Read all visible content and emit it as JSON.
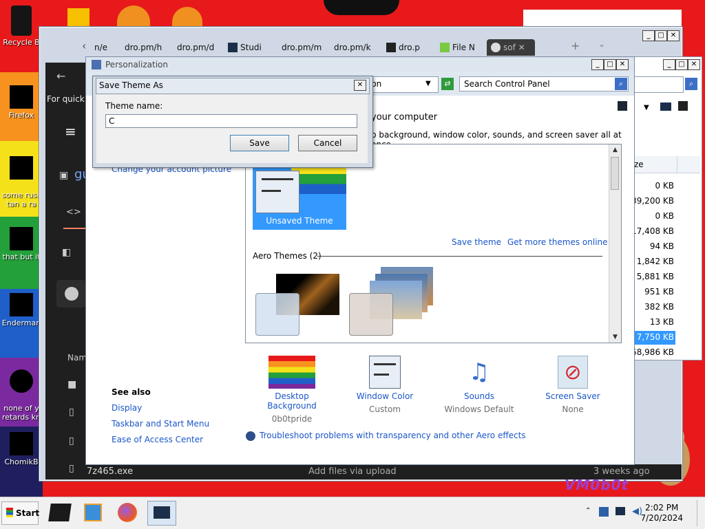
{
  "desktop": {
    "icons": [
      {
        "label": "Recycle B"
      },
      {
        "label": "Firefox"
      },
      {
        "label": "some russ\ntan a ra"
      },
      {
        "label": "that but it"
      },
      {
        "label": "Enderman"
      },
      {
        "label": "none of y\nretards kn"
      },
      {
        "label": "ChomikB"
      }
    ],
    "stripe_colors": [
      "#e8191b",
      "#f7921e",
      "#f5e11a",
      "#23a03a",
      "#1f5fc9",
      "#7a2a9e"
    ]
  },
  "browser": {
    "tabs": [
      {
        "label": "n/e"
      },
      {
        "label": "dro.pm/h"
      },
      {
        "label": "dro.pm/d"
      },
      {
        "label": "Studi"
      },
      {
        "label": "dro.pm/m"
      },
      {
        "label": "dro.pm/k"
      },
      {
        "label": "dro.p"
      },
      {
        "label": "File N"
      },
      {
        "label": "sof"
      }
    ],
    "sidebar_hint": "For quick",
    "site_text": "gu",
    "list_header": "Nam",
    "footer_file": "7z465.exe",
    "footer_upload": "Add files via upload",
    "footer_time": "3 weeks ago"
  },
  "file_manager": {
    "col_header": "ze",
    "sizes": [
      "0 KB",
      "39,200 KB",
      "0 KB",
      "17,408 KB",
      "94 KB",
      "1,842 KB",
      "5,881 KB",
      "951 KB",
      "382 KB",
      "13 KB",
      "7,750 KB",
      "558,986 KB"
    ]
  },
  "personalization": {
    "title": "Personalization",
    "address_tail": "ion",
    "search_placeholder": "Search Control Panel",
    "heading_tail": "your computer",
    "subtitle_tail": "p background, window color, sounds, and screen saver all at once.",
    "account_link": "Change your account picture",
    "unsaved_theme": "Unsaved Theme",
    "save_theme": "Save theme",
    "get_more": "Get more themes online",
    "aero_header": "Aero Themes (2)",
    "see_also": {
      "title": "See also",
      "links": [
        "Display",
        "Taskbar and Start Menu",
        "Ease of Access Center"
      ]
    },
    "bottom": [
      {
        "label": "Desktop Background",
        "value": "0b0tpride"
      },
      {
        "label": "Window Color",
        "value": "Custom"
      },
      {
        "label": "Sounds",
        "value": "Windows Default"
      },
      {
        "label": "Screen Saver",
        "value": "None"
      }
    ],
    "troubleshoot": "Troubleshoot problems with transparency and other Aero effects"
  },
  "dialog": {
    "title": "Save Theme As",
    "field_label": "Theme name:",
    "field_value": "C",
    "save": "Save",
    "cancel": "Cancel"
  },
  "taskbar": {
    "start": "Start",
    "time": "2:02 PM",
    "date": "7/20/2024",
    "watermark": "VM0b0t"
  },
  "colors": {
    "link": "#1a56c9",
    "selection": "#3399ff",
    "desktop_red": "#e8191b"
  }
}
